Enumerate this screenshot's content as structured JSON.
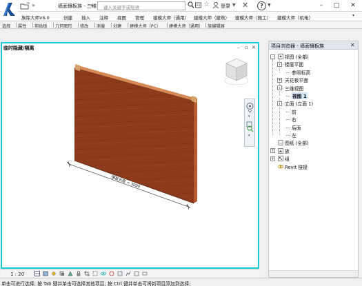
{
  "window": {
    "doc_title": "墙面镶板族 - 三维...",
    "title_more": "»",
    "qat_more": "»",
    "search_placeholder": "键入关键字或短语",
    "login_label": "登录",
    "min_glyph": "–",
    "max_glyph": "□",
    "close_glyph": "✕"
  },
  "ribbon": {
    "tabs": [
      "族库大师V6.0",
      "创建",
      "插入",
      "注释",
      "视图",
      "管理",
      "建模大师（通用）",
      "建模大师（建筑）",
      "建模大师（施工）",
      "建模大师（机电）"
    ],
    "panels": [
      "选择",
      "属性",
      "剪贴板",
      "几何图形",
      "修改",
      "测量",
      "创建",
      "建模大师（PC）",
      "建模大师（通用）",
      "族编辑器"
    ]
  },
  "view": {
    "label": "临时隐藏/隔离",
    "dimension_text": "镶板长度 = 3000",
    "scale": "1 : 20"
  },
  "browser": {
    "title": "项目浏览器 - 墙面镶板族",
    "tree": [
      {
        "label": "视图 (全部)",
        "level": 0,
        "expander": "-",
        "icon": "views-icon"
      },
      {
        "label": "楼层平面",
        "level": 1,
        "expander": "-"
      },
      {
        "label": "参照标高",
        "level": 2
      },
      {
        "label": "天花板平面",
        "level": 1,
        "expander": "+"
      },
      {
        "label": "三维视图",
        "level": 1,
        "expander": "-"
      },
      {
        "label": "视图 1",
        "level": 2,
        "selected": true
      },
      {
        "label": "立面 (立面 1)",
        "level": 1,
        "expander": "-"
      },
      {
        "label": "前",
        "level": 2
      },
      {
        "label": "右",
        "level": 2
      },
      {
        "label": "后面",
        "level": 2
      },
      {
        "label": "左",
        "level": 2
      },
      {
        "label": "图纸 (全部)",
        "level": 0,
        "icon": "sheets-icon"
      },
      {
        "label": "族",
        "level": 0,
        "expander": "+",
        "icon": "families-icon"
      },
      {
        "label": "组",
        "level": 0,
        "expander": "+",
        "icon": "groups-icon"
      },
      {
        "label": "Revit 链接",
        "level": 0,
        "icon": "revit-links-icon"
      }
    ]
  },
  "statusbar": {
    "text": "单击可进行选择; 按 Tab 键并单击可选择其他项目; 按 Ctrl 键并单击可将新项目添加到选择;"
  },
  "colors": {
    "accent": "#17c9d9",
    "wall_front": "#8b3a1c",
    "wall_side": "#b35a2e",
    "wall_top": "#d48a52"
  }
}
